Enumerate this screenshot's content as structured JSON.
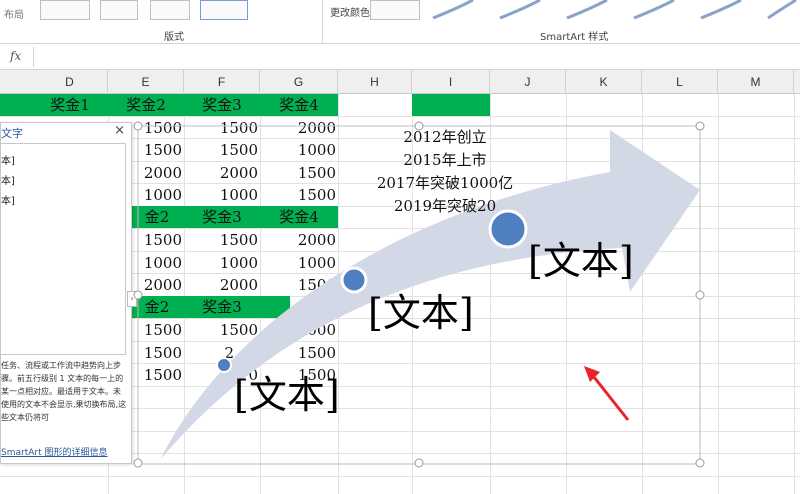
{
  "ribbon": {
    "layout_group_label": "版式",
    "smartart_styles_label": "SmartArt 样式",
    "change_colors_label": "更改颜色",
    "layout_side_label": "布局"
  },
  "formula_bar": {
    "fx_label": "fx",
    "value": ""
  },
  "columns": [
    "D",
    "E",
    "F",
    "G",
    "H",
    "I",
    "J",
    "K",
    "L",
    "M"
  ],
  "table": {
    "header1": [
      "奖金1",
      "奖金2",
      "奖金3",
      "奖金4"
    ],
    "block1": [
      [
        "1500",
        "1500",
        "2000"
      ],
      [
        "1500",
        "1500",
        "1000"
      ],
      [
        "2000",
        "2000",
        "1500"
      ],
      [
        "1000",
        "1000",
        "1500"
      ]
    ],
    "header2": [
      "金2",
      "奖金3",
      "奖金4"
    ],
    "block2": [
      [
        "1500",
        "1500",
        "2000"
      ],
      [
        "1000",
        "1000",
        "1000"
      ],
      [
        "2000",
        "2000",
        "1500"
      ]
    ],
    "header3": [
      "金2",
      "奖金3"
    ],
    "block3": [
      [
        "1500",
        "1500",
        "2000"
      ],
      [
        "1500",
        "2",
        "1500"
      ],
      [
        "1500",
        "0",
        "1500"
      ]
    ]
  },
  "text_pane": {
    "title": "文字",
    "items": [
      "本]",
      "本]",
      "本]"
    ],
    "description": "任务、流程或工作流中趋势向上步骤。前五行级别 1 文本的每一上的某一点相对应。最适用于文本。未使用的文本不会显示,果切换布局,这些文本仍将可",
    "link": "SmartArt 图形的详细信息"
  },
  "smartart": {
    "years": [
      "2012年创立",
      "2015年上市",
      "2017年突破1000亿",
      "2019年突破20"
    ],
    "labels": [
      "[文本]",
      "[文本]",
      "[文本]"
    ],
    "arrow_color": "#d3d8e6",
    "dot_color": "#4f7fc0"
  },
  "annotation_color": "#e8242a",
  "highlight_color": "#00b050"
}
